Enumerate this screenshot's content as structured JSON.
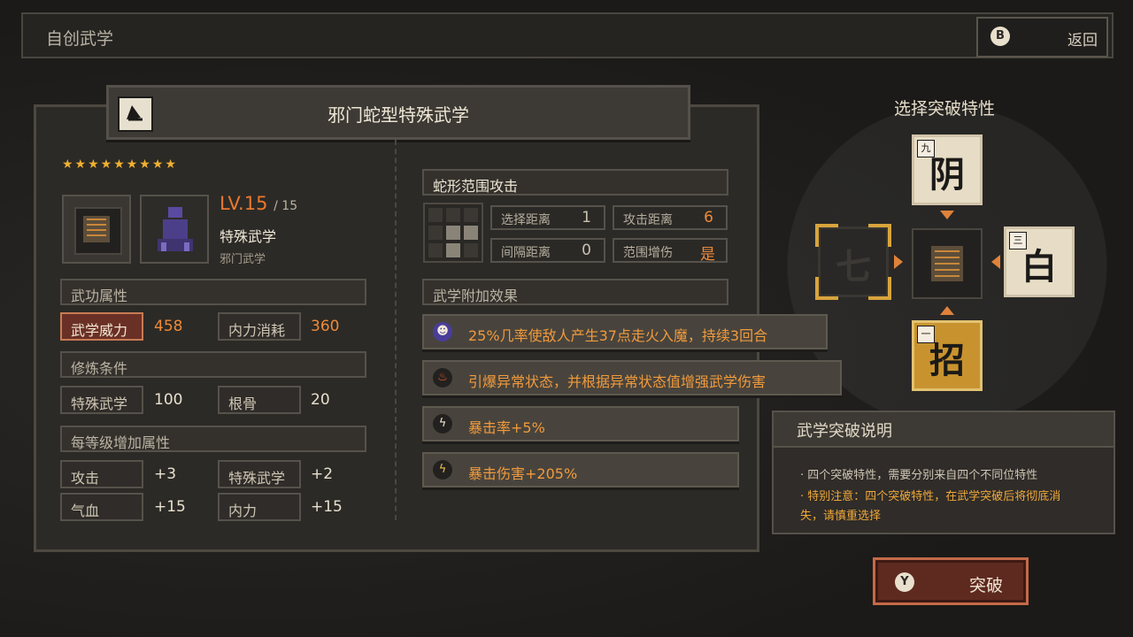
{
  "header": {
    "title": "自创武学",
    "back_key": "B",
    "back_label": "返回"
  },
  "skill": {
    "name": "邪门蛇型特殊武学",
    "stars": "★★★★★★★★★",
    "level": "LV.15",
    "level_max": "/ 15",
    "type": "特殊武学",
    "subtype": "邪门武学"
  },
  "attributes": {
    "header": "武功属性",
    "power_label": "武学威力",
    "power_value": "458",
    "mp_label": "内力消耗",
    "mp_value": "360"
  },
  "requirements": {
    "header": "修炼条件",
    "req1_label": "特殊武学",
    "req1_value": "100",
    "req2_label": "根骨",
    "req2_value": "20"
  },
  "per_level": {
    "header": "每等级增加属性",
    "items": [
      {
        "label": "攻击",
        "value": "+3"
      },
      {
        "label": "特殊武学",
        "value": "+2"
      },
      {
        "label": "气血",
        "value": "+15"
      },
      {
        "label": "内力",
        "value": "+15"
      }
    ]
  },
  "range": {
    "header": "蛇形范围攻击",
    "select_label": "选择距离",
    "select_value": "1",
    "attack_label": "攻击距离",
    "attack_value": "6",
    "gap_label": "间隔距离",
    "gap_value": "0",
    "aoe_label": "范围增伤",
    "aoe_value": "是"
  },
  "effects": {
    "header": "武学附加效果",
    "items": [
      "25%几率使敌人产生37点走火入魔，持续3回合",
      "引爆异常状态，并根据异常状态值增强武学伤害",
      "暴击率+5%",
      "暴击伤害+205%"
    ]
  },
  "breakthrough": {
    "title": "选择突破特性",
    "top": {
      "num": "九",
      "char": "阴"
    },
    "left": {
      "char": "七"
    },
    "right": {
      "num": "三",
      "char": "白"
    },
    "bottom": {
      "num": "一",
      "char": "招"
    }
  },
  "desc": {
    "header": "武学突破说明",
    "line1": "· 四个突破特性，需要分别来自四个不同位特性",
    "line2": "· 特别注意：四个突破特性，在武学突破后将彻底消",
    "line3": "失，请慎重选择"
  },
  "action": {
    "key": "Y",
    "label": "突破"
  },
  "colors": {
    "accent_orange": "#ee8a3a",
    "gold_star": "#f0b030",
    "break_red": "#5e2a20"
  }
}
